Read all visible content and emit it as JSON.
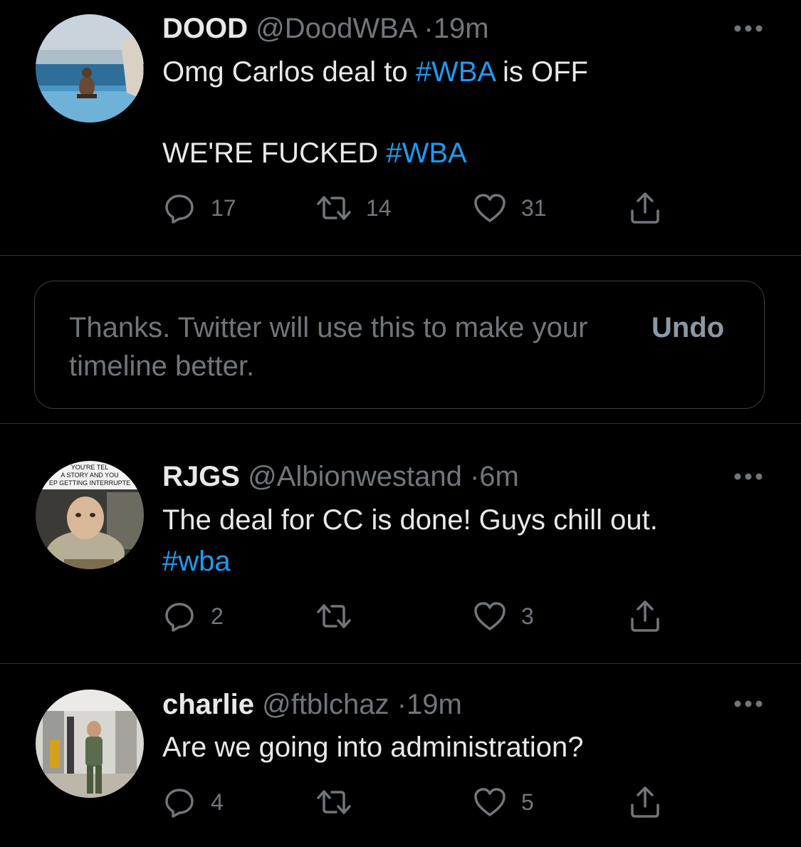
{
  "colors": {
    "background": "#000000",
    "text": "#e7e9ea",
    "muted": "#71767b",
    "hashtag": "#1d9bf0",
    "divider": "#2f3336"
  },
  "tweets": [
    {
      "name": "DOOD",
      "handle": "@DoodWBA",
      "separator": "·",
      "time": "19m",
      "avatar_icon": "avatar-pool-photo",
      "line1_text": "Omg Carlos deal to ",
      "line1_hashtag": "#WBA",
      "line1_tail": " is OFF",
      "line2_text": "WE'RE FUCKED ",
      "line2_hashtag": "#WBA",
      "replies": "17",
      "retweets": "14",
      "likes": "31"
    },
    {
      "name": "RJGS",
      "handle": "@Albionwestand",
      "separator": "·",
      "time": "6m",
      "avatar_icon": "avatar-meme-photo",
      "avatar_caption": [
        "YOU'RE TEL",
        "A STORY AND YOU",
        "EP GETTING INTERRUPTE"
      ],
      "line1_text": "The deal for CC is done! Guys chill out.",
      "line2_hashtag": "#wba",
      "replies": "2",
      "retweets": "",
      "likes": "3"
    },
    {
      "name": "charlie",
      "handle": "@ftblchaz",
      "separator": "·",
      "time": "19m",
      "avatar_icon": "avatar-gym-selfie-photo",
      "line1_text": "Are we going into administration?",
      "replies": "4",
      "retweets": "",
      "likes": "5"
    }
  ],
  "feedback": {
    "message": "Thanks. Twitter will use this to make your timeline better.",
    "undo_label": "Undo"
  },
  "icons": {
    "reply": "reply-icon",
    "retweet": "retweet-icon",
    "like": "heart-icon",
    "share": "share-icon",
    "more": "more-options-icon"
  }
}
